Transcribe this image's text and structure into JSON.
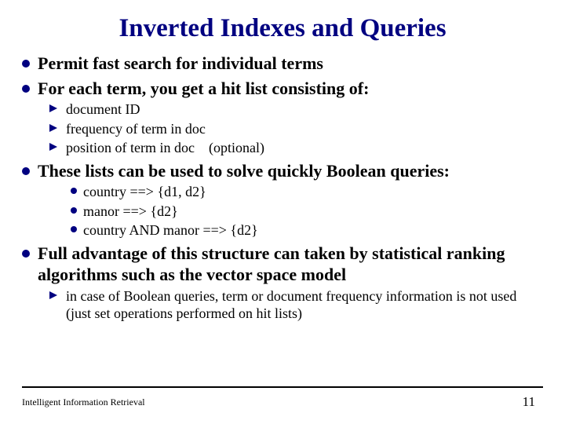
{
  "title": "Inverted Indexes and Queries",
  "bullets": {
    "b1": "Permit fast search for individual terms",
    "b2": "For each term, you get a hit list consisting of:",
    "b2_1": "document ID",
    "b2_2": "frequency of term in doc",
    "b2_3": "position of term in doc (optional)",
    "b3": "These lists can be used to solve quickly Boolean queries:",
    "b3_1": "country ==> {d1, d2}",
    "b3_2": "manor ==> {d2}",
    "b3_3": "country AND manor ==> {d2}",
    "b4": "Full advantage of this structure can taken by statistical ranking algorithms such as the vector space model",
    "b4_1": "in case of Boolean queries, term or document frequency information is not used (just set operations performed on hit lists)"
  },
  "footer": {
    "left": "Intelligent Information Retrieval",
    "page": "11"
  }
}
